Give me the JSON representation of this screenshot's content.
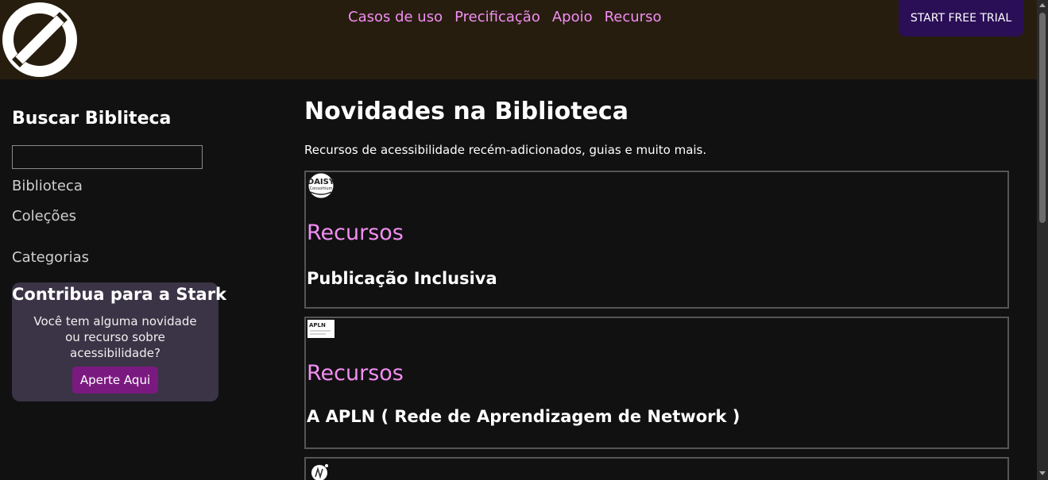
{
  "header": {
    "nav": [
      "Casos de uso",
      "Precificação",
      "Apoio",
      "Recurso"
    ],
    "trial_button": "START FREE TRIAL"
  },
  "sidebar": {
    "search_title": "Buscar Bibliteca",
    "search_value": "",
    "links": [
      "Biblioteca",
      "Coleções",
      "Categorias"
    ],
    "contribute": {
      "title": "Contribua para a Stark",
      "text": "Você tem alguma novidade ou recurso sobre acessibilidade?",
      "button": "Aperte Aqui"
    }
  },
  "main": {
    "title": "Novidades na Biblioteca",
    "subtitle": "Recursos de acessibilidade recém-adicionados, guias e muito mais.",
    "cards": [
      {
        "logo_text": "DAISY",
        "logo_sub": "Consortium",
        "type": "Recursos",
        "title": "Publicação Inclusiva"
      },
      {
        "logo_text": "APLN",
        "type": "Recursos",
        "title": "A APLN ( Rede de Aprendizagem de Network )"
      },
      {
        "type": "",
        "title": ""
      }
    ]
  },
  "colors": {
    "header_bg": "#271d0f",
    "page_bg": "#121112",
    "accent_pink": "#f28ef2",
    "trial_bg": "#2a0f56",
    "contrib_bg": "#3b3446",
    "contrib_btn": "#7a1a80"
  }
}
